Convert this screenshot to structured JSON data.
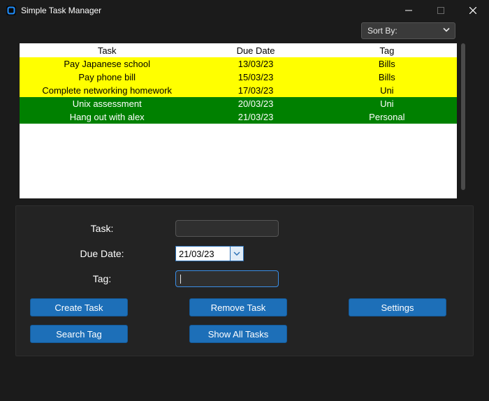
{
  "window": {
    "title": "Simple Task Manager"
  },
  "sort": {
    "label": "Sort By:"
  },
  "table": {
    "headers": {
      "task": "Task",
      "due": "Due Date",
      "tag": "Tag"
    },
    "rows": [
      {
        "task": "Pay Japanese school",
        "due": "13/03/23",
        "tag": "Bills",
        "rowClass": "row-yellow"
      },
      {
        "task": "Pay phone bill",
        "due": "15/03/23",
        "tag": "Bills",
        "rowClass": "row-yellow"
      },
      {
        "task": "Complete networking homework",
        "due": "17/03/23",
        "tag": "Uni",
        "rowClass": "row-yellow"
      },
      {
        "task": "Unix assessment",
        "due": "20/03/23",
        "tag": "Uni",
        "rowClass": "row-green"
      },
      {
        "task": "Hang out with alex",
        "due": "21/03/23",
        "tag": "Personal",
        "rowClass": "row-green"
      }
    ]
  },
  "form": {
    "labels": {
      "task": "Task:",
      "due": "Due Date:",
      "tag": "Tag:"
    },
    "values": {
      "task": "",
      "due": "21/03/23",
      "tag": ""
    }
  },
  "buttons": {
    "create": "Create Task",
    "remove": "Remove Task",
    "settings": "Settings",
    "search": "Search Tag",
    "showall": "Show All Tasks"
  }
}
